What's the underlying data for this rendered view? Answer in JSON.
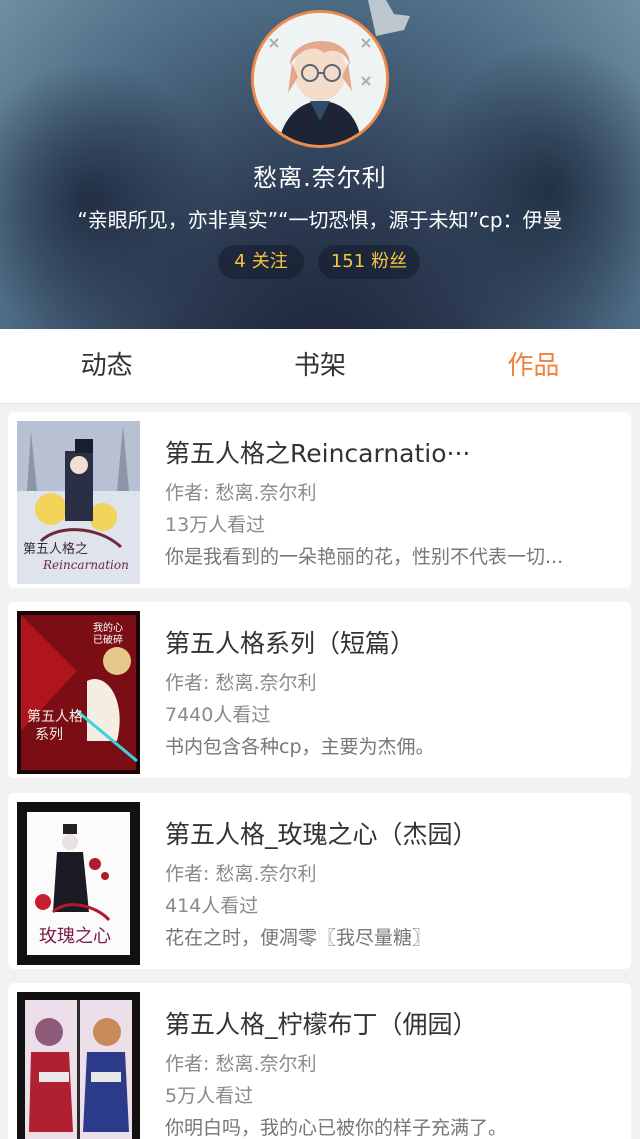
{
  "profile": {
    "nickname": "愁离.奈尔利",
    "signature": "“亲眼所见，亦非真实”“一切恐惧，源于未知”cp：伊曼",
    "follow_count": "4",
    "follow_label": "关注",
    "fans_count": "151",
    "fans_label": "粉丝",
    "avatar_border_color": "#f08a4b"
  },
  "tabs": [
    {
      "label": "动态",
      "active": false
    },
    {
      "label": "书架",
      "active": false
    },
    {
      "label": "作品",
      "active": true
    }
  ],
  "accent_color": "#f0843c",
  "works": [
    {
      "title": "第五人格之Reincarnatio···",
      "author": "作者: 愁离.奈尔利",
      "views": "13万人看过",
      "description": "你是我看到的一朵艳丽的花，性别不代表一切..."
    },
    {
      "title": "第五人格系列（短篇）",
      "author": "作者: 愁离.奈尔利",
      "views": "7440人看过",
      "description": "书内包含各种cp，主要为杰佣。"
    },
    {
      "title": "第五人格_玫瑰之心（杰园）",
      "author": "作者: 愁离.奈尔利",
      "views": "414人看过",
      "description": "花在之时，便凋零〖我尽量糖〗"
    },
    {
      "title": "第五人格_柠檬布丁（佣园）",
      "author": "作者: 愁离.奈尔利",
      "views": "5万人看过",
      "description": "你明白吗，我的心已被你的样子充满了。"
    }
  ]
}
